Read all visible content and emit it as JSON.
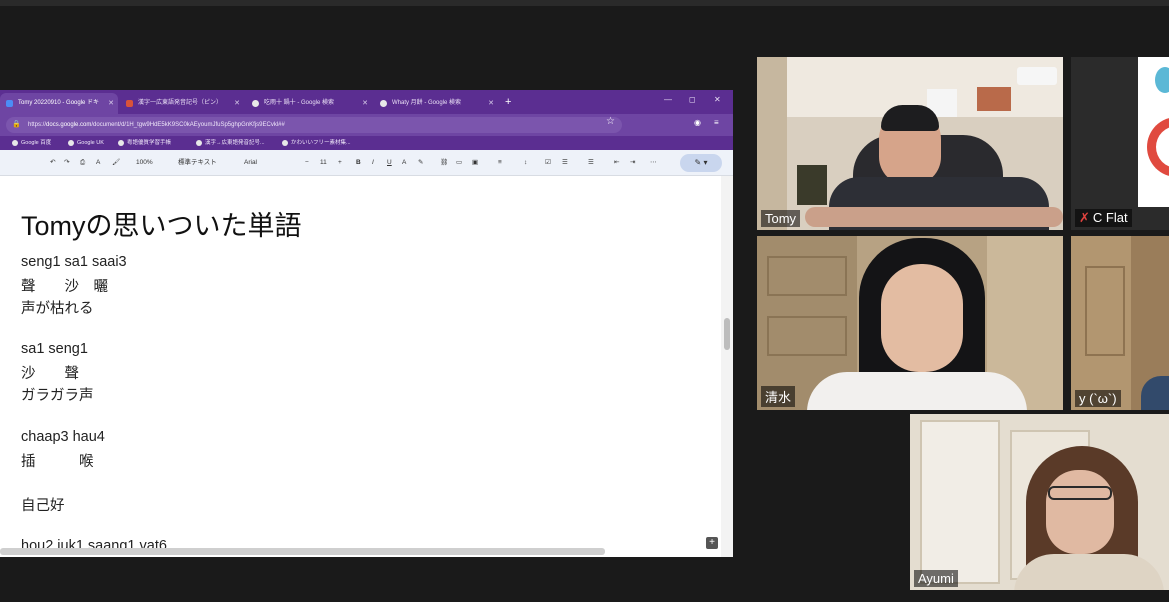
{
  "browser": {
    "tabs": [
      {
        "label": "Tomy 20220910 - Google ドキ",
        "active": true
      },
      {
        "label": "漢字一広東語発音記号（ピン）",
        "active": false
      },
      {
        "label": "吃雨十 鍋十 - Google 検索",
        "active": false
      },
      {
        "label": "Whaty 月餅 - Google 検索",
        "active": false
      }
    ],
    "new_tab": "+",
    "window_controls": [
      "—",
      "◻",
      "✕"
    ],
    "url_scheme": "https://",
    "url_host": "docs.google.com",
    "url_path": "/document/d/1H_tgw9HdE5kK9SC0kAEyoumJfuSp5ghpGnKfjs9ECvkl##",
    "bookmarks": [
      "Google 百度",
      "Google UK",
      "粤語優質学習手帳",
      "漢字→広東語発音記号...",
      "かわいいフリー素材集..."
    ],
    "toolbar": {
      "zoom": "100%",
      "style": "標準テキスト",
      "font": "Arial",
      "size": "11"
    }
  },
  "document": {
    "title": "Tomyの思いついた単語",
    "lines": [
      "seng1 sa1 saai3",
      "聲　　沙　曬",
      "声が枯れる",
      "sa1 seng1",
      "沙　　聲",
      "ガラガラ声",
      "chaap3 hau4",
      "插　　　喉",
      "自己好",
      "hou2 juk1 saang1 vat6"
    ]
  },
  "participants": [
    {
      "name": "Tomy",
      "muted": false
    },
    {
      "name": "C Flat",
      "muted": true
    },
    {
      "name": "清水",
      "muted": false
    },
    {
      "name": "y (`ω`)",
      "muted": false
    },
    {
      "name": "Ayumi",
      "muted": false,
      "active_speaker": true
    }
  ],
  "colors": {
    "browser_purple": "#5b2e91",
    "speaker_highlight": "#c7e05a",
    "mute_red": "#e0433f"
  }
}
